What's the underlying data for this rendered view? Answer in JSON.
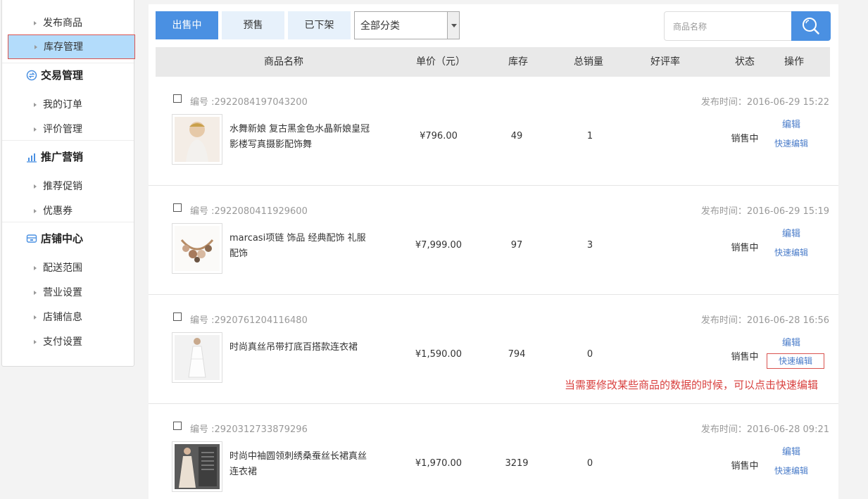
{
  "sidebar": {
    "items": [
      {
        "label": "发布商品"
      },
      {
        "label": "库存管理"
      },
      {
        "label": "我的订单"
      },
      {
        "label": "评价管理"
      },
      {
        "label": "推荐促销"
      },
      {
        "label": "优惠券"
      },
      {
        "label": "配送范围"
      },
      {
        "label": "营业设置"
      },
      {
        "label": "店铺信息"
      },
      {
        "label": "支付设置"
      }
    ],
    "groups": [
      {
        "label": "交易管理",
        "icon": "exchange-icon"
      },
      {
        "label": "推广营销",
        "icon": "bar-chart-icon"
      },
      {
        "label": "店铺中心",
        "icon": "store-icon"
      }
    ]
  },
  "toolbar": {
    "tabs": [
      "出售中",
      "预售",
      "已下架"
    ],
    "category_value": "全部分类",
    "search_placeholder": "商品名称"
  },
  "table": {
    "headers": [
      "商品名称",
      "单价（元）",
      "库存",
      "总销量",
      "好评率",
      "状态",
      "操作"
    ]
  },
  "products": [
    {
      "id": "编号 :2922084197043200",
      "date": "发布时间：2016-06-29 15:22",
      "name": "水舞新娘 复古黑金色水晶新娘皇冠影楼写真摄影配饰舞",
      "price": "¥796.00",
      "stock": "49",
      "sales": "1",
      "status": "销售中",
      "edit": "编辑",
      "quick_edit": "快速编辑"
    },
    {
      "id": "编号 :2922080411929600",
      "date": "发布时间：2016-06-29 15:19",
      "name": "marcasi项链 饰品 经典配饰 礼服配饰",
      "price": "¥7,999.00",
      "stock": "97",
      "sales": "3",
      "status": "销售中",
      "edit": "编辑",
      "quick_edit": "快速编辑"
    },
    {
      "id": "编号 :2920761204116480",
      "date": "发布时间：2016-06-28 16:56",
      "name": "时尚真丝吊带打底百搭款连衣裙",
      "price": "¥1,590.00",
      "stock": "794",
      "sales": "0",
      "status": "销售中",
      "edit": "编辑",
      "quick_edit": "快速编辑"
    },
    {
      "id": "编号 :2920312733879296",
      "date": "发布时间：2016-06-28 09:21",
      "name": "时尚中袖圆领刺绣桑蚕丝长裙真丝连衣裙",
      "price": "¥1,970.00",
      "stock": "3219",
      "sales": "0",
      "status": "销售中",
      "edit": "编辑",
      "quick_edit": "快速编辑"
    }
  ],
  "annotation": "当需要修改某些商品的数据的时候，可以点击快速编辑",
  "colors": {
    "accent": "#4a90e2",
    "highlight": "#b3dcfb",
    "annotation": "#d9413f"
  }
}
